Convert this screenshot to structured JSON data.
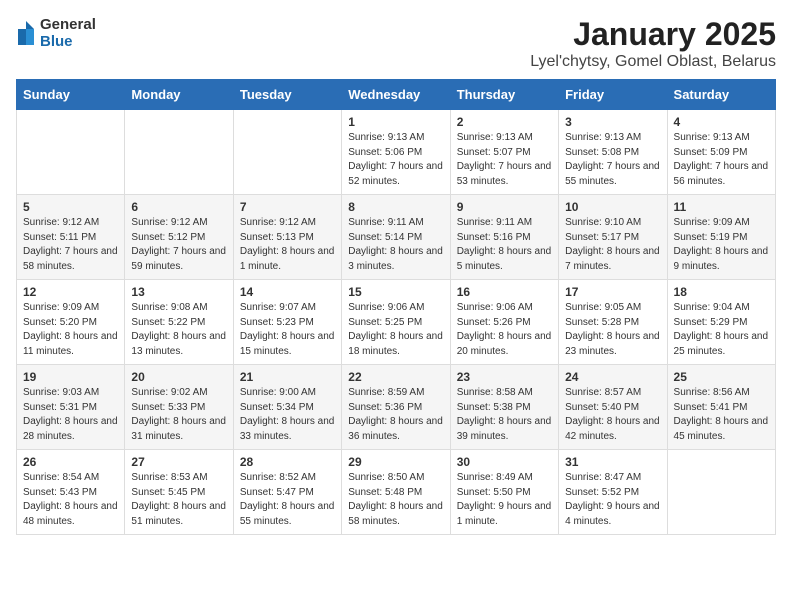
{
  "logo": {
    "line1": "General",
    "line2": "Blue"
  },
  "title": "January 2025",
  "subtitle": "Lyel'chytsy, Gomel Oblast, Belarus",
  "weekdays": [
    "Sunday",
    "Monday",
    "Tuesday",
    "Wednesday",
    "Thursday",
    "Friday",
    "Saturday"
  ],
  "weeks": [
    [
      {
        "day": "",
        "info": ""
      },
      {
        "day": "",
        "info": ""
      },
      {
        "day": "",
        "info": ""
      },
      {
        "day": "1",
        "info": "Sunrise: 9:13 AM\nSunset: 5:06 PM\nDaylight: 7 hours and 52 minutes."
      },
      {
        "day": "2",
        "info": "Sunrise: 9:13 AM\nSunset: 5:07 PM\nDaylight: 7 hours and 53 minutes."
      },
      {
        "day": "3",
        "info": "Sunrise: 9:13 AM\nSunset: 5:08 PM\nDaylight: 7 hours and 55 minutes."
      },
      {
        "day": "4",
        "info": "Sunrise: 9:13 AM\nSunset: 5:09 PM\nDaylight: 7 hours and 56 minutes."
      }
    ],
    [
      {
        "day": "5",
        "info": "Sunrise: 9:12 AM\nSunset: 5:11 PM\nDaylight: 7 hours and 58 minutes."
      },
      {
        "day": "6",
        "info": "Sunrise: 9:12 AM\nSunset: 5:12 PM\nDaylight: 7 hours and 59 minutes."
      },
      {
        "day": "7",
        "info": "Sunrise: 9:12 AM\nSunset: 5:13 PM\nDaylight: 8 hours and 1 minute."
      },
      {
        "day": "8",
        "info": "Sunrise: 9:11 AM\nSunset: 5:14 PM\nDaylight: 8 hours and 3 minutes."
      },
      {
        "day": "9",
        "info": "Sunrise: 9:11 AM\nSunset: 5:16 PM\nDaylight: 8 hours and 5 minutes."
      },
      {
        "day": "10",
        "info": "Sunrise: 9:10 AM\nSunset: 5:17 PM\nDaylight: 8 hours and 7 minutes."
      },
      {
        "day": "11",
        "info": "Sunrise: 9:09 AM\nSunset: 5:19 PM\nDaylight: 8 hours and 9 minutes."
      }
    ],
    [
      {
        "day": "12",
        "info": "Sunrise: 9:09 AM\nSunset: 5:20 PM\nDaylight: 8 hours and 11 minutes."
      },
      {
        "day": "13",
        "info": "Sunrise: 9:08 AM\nSunset: 5:22 PM\nDaylight: 8 hours and 13 minutes."
      },
      {
        "day": "14",
        "info": "Sunrise: 9:07 AM\nSunset: 5:23 PM\nDaylight: 8 hours and 15 minutes."
      },
      {
        "day": "15",
        "info": "Sunrise: 9:06 AM\nSunset: 5:25 PM\nDaylight: 8 hours and 18 minutes."
      },
      {
        "day": "16",
        "info": "Sunrise: 9:06 AM\nSunset: 5:26 PM\nDaylight: 8 hours and 20 minutes."
      },
      {
        "day": "17",
        "info": "Sunrise: 9:05 AM\nSunset: 5:28 PM\nDaylight: 8 hours and 23 minutes."
      },
      {
        "day": "18",
        "info": "Sunrise: 9:04 AM\nSunset: 5:29 PM\nDaylight: 8 hours and 25 minutes."
      }
    ],
    [
      {
        "day": "19",
        "info": "Sunrise: 9:03 AM\nSunset: 5:31 PM\nDaylight: 8 hours and 28 minutes."
      },
      {
        "day": "20",
        "info": "Sunrise: 9:02 AM\nSunset: 5:33 PM\nDaylight: 8 hours and 31 minutes."
      },
      {
        "day": "21",
        "info": "Sunrise: 9:00 AM\nSunset: 5:34 PM\nDaylight: 8 hours and 33 minutes."
      },
      {
        "day": "22",
        "info": "Sunrise: 8:59 AM\nSunset: 5:36 PM\nDaylight: 8 hours and 36 minutes."
      },
      {
        "day": "23",
        "info": "Sunrise: 8:58 AM\nSunset: 5:38 PM\nDaylight: 8 hours and 39 minutes."
      },
      {
        "day": "24",
        "info": "Sunrise: 8:57 AM\nSunset: 5:40 PM\nDaylight: 8 hours and 42 minutes."
      },
      {
        "day": "25",
        "info": "Sunrise: 8:56 AM\nSunset: 5:41 PM\nDaylight: 8 hours and 45 minutes."
      }
    ],
    [
      {
        "day": "26",
        "info": "Sunrise: 8:54 AM\nSunset: 5:43 PM\nDaylight: 8 hours and 48 minutes."
      },
      {
        "day": "27",
        "info": "Sunrise: 8:53 AM\nSunset: 5:45 PM\nDaylight: 8 hours and 51 minutes."
      },
      {
        "day": "28",
        "info": "Sunrise: 8:52 AM\nSunset: 5:47 PM\nDaylight: 8 hours and 55 minutes."
      },
      {
        "day": "29",
        "info": "Sunrise: 8:50 AM\nSunset: 5:48 PM\nDaylight: 8 hours and 58 minutes."
      },
      {
        "day": "30",
        "info": "Sunrise: 8:49 AM\nSunset: 5:50 PM\nDaylight: 9 hours and 1 minute."
      },
      {
        "day": "31",
        "info": "Sunrise: 8:47 AM\nSunset: 5:52 PM\nDaylight: 9 hours and 4 minutes."
      },
      {
        "day": "",
        "info": ""
      }
    ]
  ]
}
